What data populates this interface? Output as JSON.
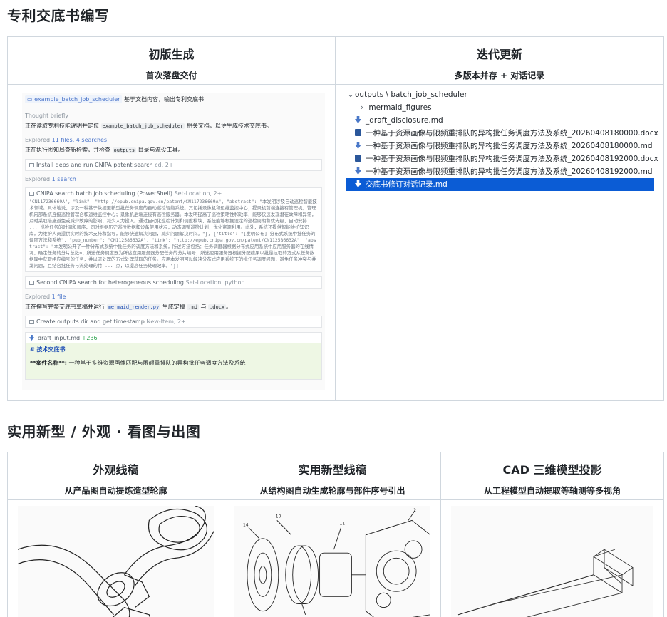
{
  "sections": {
    "patent_title": "专利交底书编写",
    "drawing_title": "实用新型 / 外观 · 看图与出图"
  },
  "top": {
    "left": {
      "heading": "初版生成",
      "sub": "首次落盘交付"
    },
    "right": {
      "heading": "迭代更新",
      "sub": "多版本并存 + 对话记录"
    }
  },
  "chat": {
    "skill_chip": "example_batch_job_scheduler",
    "skill_text": "基于文档内容，输出专利交底书",
    "thought": "Thought briefly",
    "line1_a": "正在读取专利技能说明并定位",
    "line1_code": "example_batch_job_scheduler",
    "line1_b": "相关文档，以便生成技术交底书。",
    "explored1": "Explored 11 files, 4 searches",
    "line2_a": "正在执行图知局查新检索，并检查",
    "line2_code": "outputs",
    "line2_b": "目录与流设工具。",
    "tool1_a": "Install deps and run CNIPA patent search",
    "tool1_b": "cd, 2+",
    "explored2": "Explored 1 search",
    "tool2_a": "CNIPA search batch job scheduling (PowerShell)",
    "tool2_b": "Set-Location, 2+",
    "tool2_out": "\"CN117236669A\", \"link\": \"http://epub.cnipa.gov.cn/patent/CN117236669A\", \"abstract\": \"本发明涉及自动巡检智能技术领域。具体地说，涉及一种基于数据更新型批任务调度的自动巡检智能系统。其包括录像机和运维监控中心；提录机前端连接有管理机，管理机内部系统连接巡检管理合和运维监控中心；录象机后端连接有巡检服务器。本发明提高了巡检策略性和效率，能够快速发现潜在故障和异常，及时采取措施避免或减少故障的影响，减少人力投入。通过自动化巡检计划和调度模块，系统能够根据设定的巡检周期和优先级，自动安排 ... 巡检任务的时间和顺序，同时根据历史巡检数据和设备使用状况，动态调整巡检计划，优化资源利用。此外，系统还提供智能维护知识库，为维护人员提供实时的技术支持和指导，能够快速解决问题，减少问题解决时间。\"}, {\"title\": \"[发明公布] 分布式系统中批任务的调度方法和系统\", \"pub_number\": \"CN112586632A\", \"link\": \"http://epub.cnipa.gov.cn/patent/CN112586632A\", \"abstract\": \"本发明公开了一种分布式系统中批任务的调度方法和系统，所述方法包括：任务调度器根据分布式应用系统中应用服务器的在线情况，确定任务的分片总数n；所述任务调度器为所述应用服务器分配任务的分片编号；所述应用服务器根据分配结果以批量拉取的方式从任务数据库中获取相应编号的任务，并以流处理的方式处理获取的任务。应用本发明可以解决分布式应用系统下的批任务调度问题，避免任务冲突与并发问题，且结合批任务与流处理的特 ... 点，以提高任务处理效率。\"}]",
    "tool3_a": "Second CNIPA search for heterogeneous scheduling",
    "tool3_b": "Set-Location, python",
    "explored3": "Explored 1 file",
    "line3_a": "正在撰写完整交底书草稿并运行",
    "line3_code": "mermaid_render.py",
    "line3_b": "生成定稿",
    "line3_c": ".md",
    "line3_d": "与",
    "line3_e": ".docx",
    "line3_f": "。",
    "tool4_a": "Create outputs dir and get timestamp",
    "tool4_b": "New-Item, 2+",
    "diff_file": "draft_input.md",
    "diff_plus": "+236",
    "diff_h": "# 技术交底书",
    "diff_name_label": "**案件名称**:",
    "diff_name_val": "一种基于多维资源画像匹配与限额重排队的异构批任务调度方法及系统"
  },
  "explorer": {
    "root": "outputs \\ batch_job_scheduler",
    "items": [
      {
        "type": "folder",
        "name": "mermaid_figures"
      },
      {
        "type": "md",
        "name": "_draft_disclosure.md"
      },
      {
        "type": "docx",
        "name": "一种基于资源画像与限频重排队的异构批任务调度方法及系统_20260408180000.docx"
      },
      {
        "type": "md",
        "name": "一种基于资源画像与限频重排队的异构批任务调度方法及系统_20260408180000.md"
      },
      {
        "type": "docx",
        "name": "一种基于资源画像与限频重排队的异构批任务调度方法及系统_20260408192000.docx"
      },
      {
        "type": "md",
        "name": "一种基于资源画像与限频重排队的异构批任务调度方法及系统_20260408192000.md"
      },
      {
        "type": "md",
        "name": "交底书修订对话记录.md",
        "selected": true
      }
    ]
  },
  "bottom": [
    {
      "heading": "外观线稿",
      "sub": "从产品图自动提炼造型轮廓"
    },
    {
      "heading": "实用新型线稿",
      "sub": "从结构图自动生成轮廓与部件序号引出"
    },
    {
      "heading": "CAD 三维模型投影",
      "sub": "从工程模型自动提取等轴测等多视角"
    }
  ]
}
